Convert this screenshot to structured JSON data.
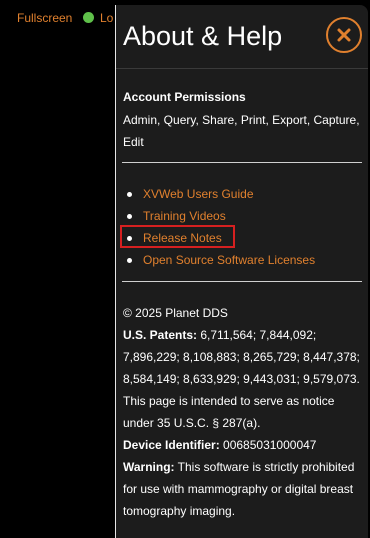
{
  "background": {
    "fullscreen_label": "Fullscreen",
    "status_label": "Lo"
  },
  "panel": {
    "title": "About & Help",
    "close_icon": "close-x-icon",
    "permissions": {
      "heading": "Account Permissions",
      "list": "Admin, Query, Share, Print, Export, Capture, Edit"
    },
    "links": [
      {
        "label": "XVWeb Users Guide"
      },
      {
        "label": "Training Videos"
      },
      {
        "label": "Release Notes",
        "highlighted": true
      },
      {
        "label": "Open Source Software Licenses"
      }
    ],
    "legal": {
      "copyright": "© 2025 Planet DDS",
      "patents_label": "U.S. Patents:",
      "patents_value": " 6,711,564; 7,844,092; 7,896,229; 8,108,883; 8,265,729; 8,447,378; 8,584,149; 8,633,929; 9,443,031; 9,579,073.",
      "notice": "This page is intended to serve as notice under 35 U.S.C. § 287(a).",
      "device_label": "Device Identifier:",
      "device_value": " 00685031000047",
      "warning_label": "Warning:",
      "warning_value": " This software is strictly prohibited for use with mammography or digital breast tomography imaging."
    }
  },
  "colors": {
    "accent": "#e0802e",
    "panel_bg": "#1c1c1c",
    "highlight": "#d62020",
    "status_dot": "#5fc04a"
  }
}
